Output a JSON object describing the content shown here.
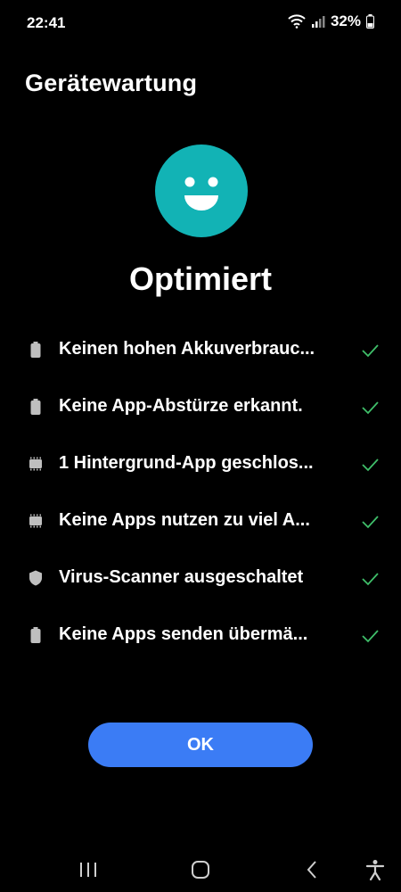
{
  "status_bar": {
    "time": "22:41",
    "battery_percent": "32%",
    "icons": [
      "wifi-icon",
      "signal-icon",
      "battery-icon"
    ]
  },
  "header": {
    "title": "Gerätewartung"
  },
  "summary": {
    "icon": "smiley-face-icon",
    "icon_color": "#12b3b5",
    "status": "Optimiert"
  },
  "checks": [
    {
      "icon": "battery-icon",
      "label": "Keinen hohen Akkuverbrauc...",
      "status_icon": "checkmark-icon"
    },
    {
      "icon": "battery-icon",
      "label": "Keine App-Abstürze erkannt.",
      "status_icon": "checkmark-icon"
    },
    {
      "icon": "memory-chip-icon",
      "label": "1 Hintergrund-App geschlos...",
      "status_icon": "checkmark-icon"
    },
    {
      "icon": "memory-chip-icon",
      "label": "Keine Apps nutzen zu viel A...",
      "status_icon": "checkmark-icon"
    },
    {
      "icon": "shield-icon",
      "label": "Virus-Scanner ausgeschaltet",
      "status_icon": "checkmark-icon"
    },
    {
      "icon": "battery-icon",
      "label": "Keine Apps senden übermä...",
      "status_icon": "checkmark-icon"
    }
  ],
  "ok_button": {
    "label": "OK",
    "color": "#3b7cf5"
  },
  "colors": {
    "background": "#000000",
    "check": "#3fbf6a",
    "row_icon": "#bfbfbf"
  },
  "navigation": {
    "items": [
      "recent-apps-icon",
      "home-icon",
      "back-icon",
      "accessibility-icon"
    ]
  }
}
